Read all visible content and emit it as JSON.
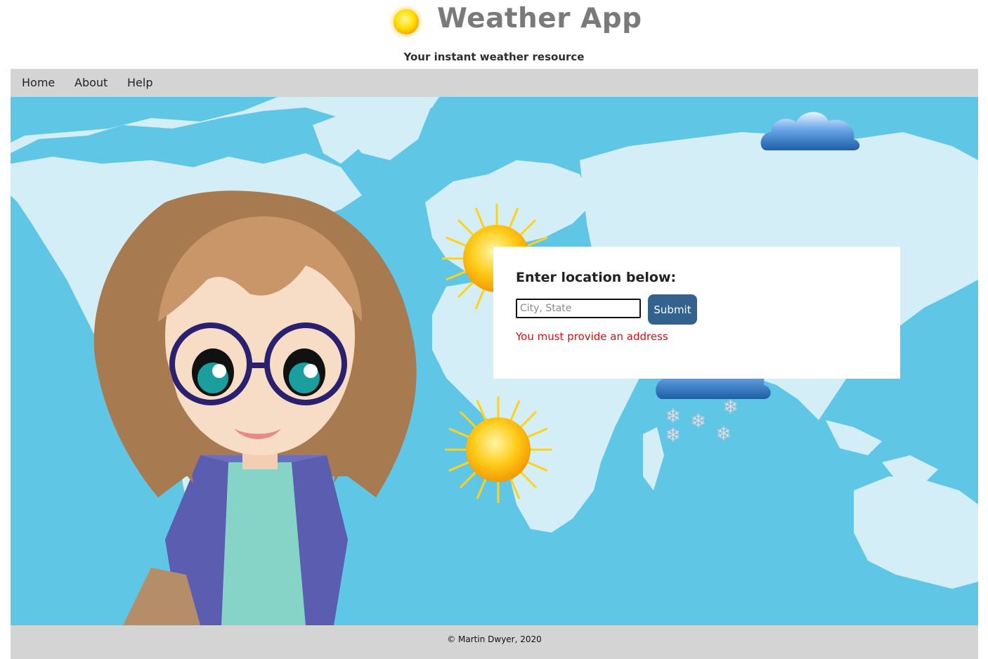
{
  "header": {
    "title": "Weather App",
    "tagline": "Your instant weather resource",
    "logo_icon": "sun-icon"
  },
  "nav": {
    "items": [
      {
        "label": "Home"
      },
      {
        "label": "About"
      },
      {
        "label": "Help"
      }
    ]
  },
  "form": {
    "heading": "Enter location below:",
    "input_placeholder": "City, State",
    "input_value": "",
    "submit_label": "Submit",
    "error_message": "You must provide an address"
  },
  "footer": {
    "copyright": "© Martin Dwyer, 2020"
  },
  "colors": {
    "ocean": "#5fc7e5",
    "land": "#d3eef7",
    "nav_bg": "#d4d4d4",
    "button": "#32628d",
    "error": "#d41111",
    "title": "#7a7a7a"
  },
  "decor": [
    "world-map",
    "sun-icon",
    "cloud-icon",
    "snow-cloud-icon",
    "cartoon-girl"
  ]
}
